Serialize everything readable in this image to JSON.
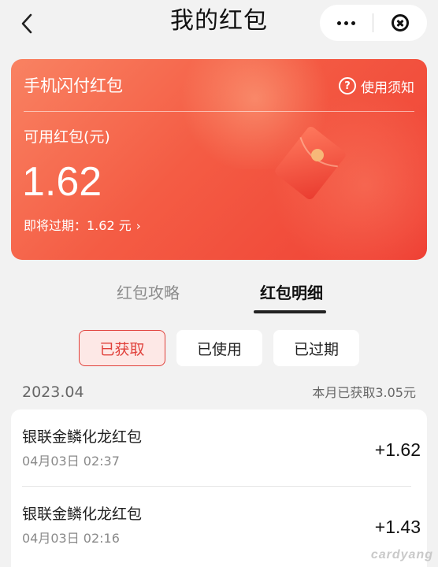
{
  "header": {
    "title": "我的红包"
  },
  "card": {
    "title": "手机闪付红包",
    "rules_label": "使用须知",
    "balance_label": "可用红包(元)",
    "balance_value": "1.62",
    "expiry_text": "即将过期：1.62 元"
  },
  "tabs": [
    {
      "label": "红包攻略",
      "active": false
    },
    {
      "label": "红包明细",
      "active": true
    }
  ],
  "filters": [
    {
      "label": "已获取",
      "selected": true
    },
    {
      "label": "已使用",
      "selected": false
    },
    {
      "label": "已过期",
      "selected": false
    }
  ],
  "month": {
    "label": "2023.04",
    "summary": "本月已获取3.05元"
  },
  "records": [
    {
      "name": "银联金鳞化龙红包",
      "time": "04月03日 02:37",
      "amount": "+1.62"
    },
    {
      "name": "银联金鳞化龙红包",
      "time": "04月03日 02:16",
      "amount": "+1.43"
    }
  ],
  "watermark": "cardyang",
  "colors": {
    "accent": "#e0403a",
    "card_start": "#f98262",
    "card_end": "#ef4034",
    "background": "#f2f2f2"
  }
}
